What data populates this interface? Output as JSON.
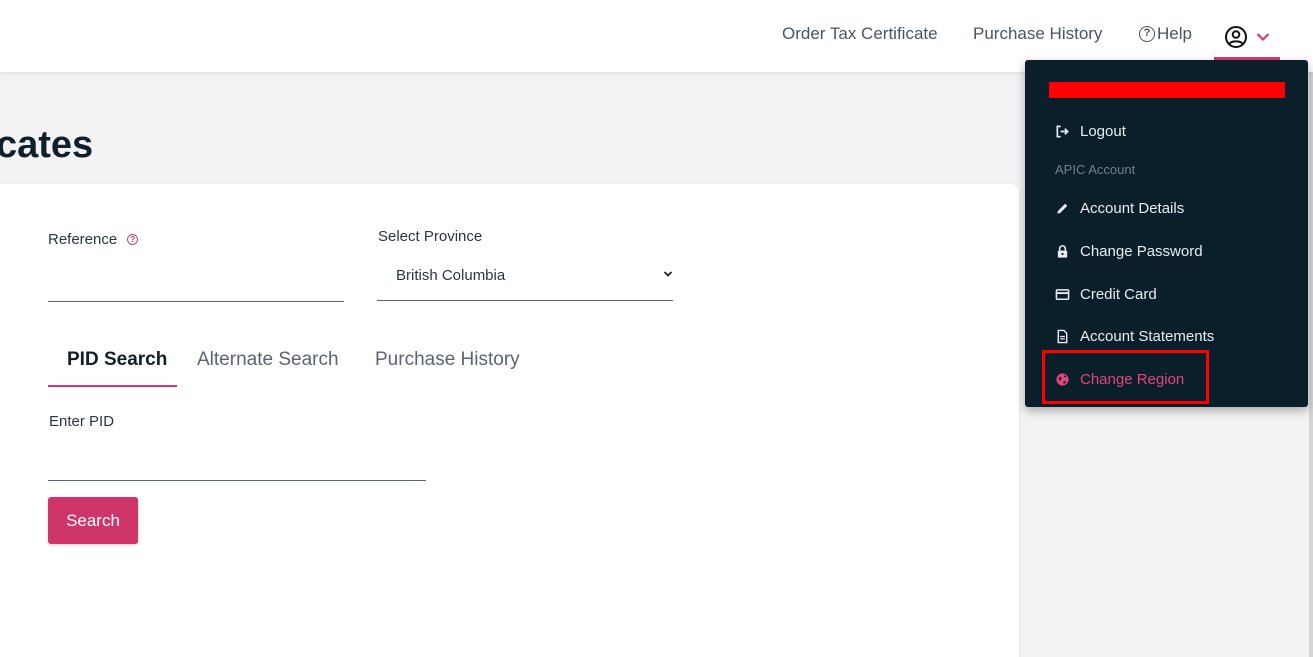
{
  "header": {
    "nav": {
      "order_tax_certificate": "Order Tax Certificate",
      "purchase_history": "Purchase History",
      "help": "Help"
    },
    "user_icon": "user-circle-icon",
    "menu_chevron_icon": "chevron-down-icon"
  },
  "page": {
    "title": "cates"
  },
  "form": {
    "reference": {
      "label": "Reference",
      "value": ""
    },
    "province": {
      "label": "Select Province",
      "value": "British Columbia"
    },
    "tabs": [
      {
        "label": "PID Search",
        "active": true
      },
      {
        "label": "Alternate Search",
        "active": false
      },
      {
        "label": "Purchase History",
        "active": false
      }
    ],
    "pid": {
      "label": "Enter PID",
      "value": ""
    },
    "search_button": "Search"
  },
  "user_menu": {
    "items": {
      "logout": "Logout",
      "section_label": "APIC Account",
      "account_details": "Account Details",
      "change_password": "Change Password",
      "credit_card": "Credit Card",
      "account_statements": "Account Statements",
      "change_region": "Change Region"
    },
    "icons": [
      "logout-icon",
      "pencil-icon",
      "lock-icon",
      "credit-card-icon",
      "document-icon",
      "globe-icon"
    ]
  },
  "colors": {
    "accent": "#cf3568",
    "menu_background": "#0b1f2b",
    "highlight": "#ff0000",
    "page_background": "#f3f3f4"
  }
}
